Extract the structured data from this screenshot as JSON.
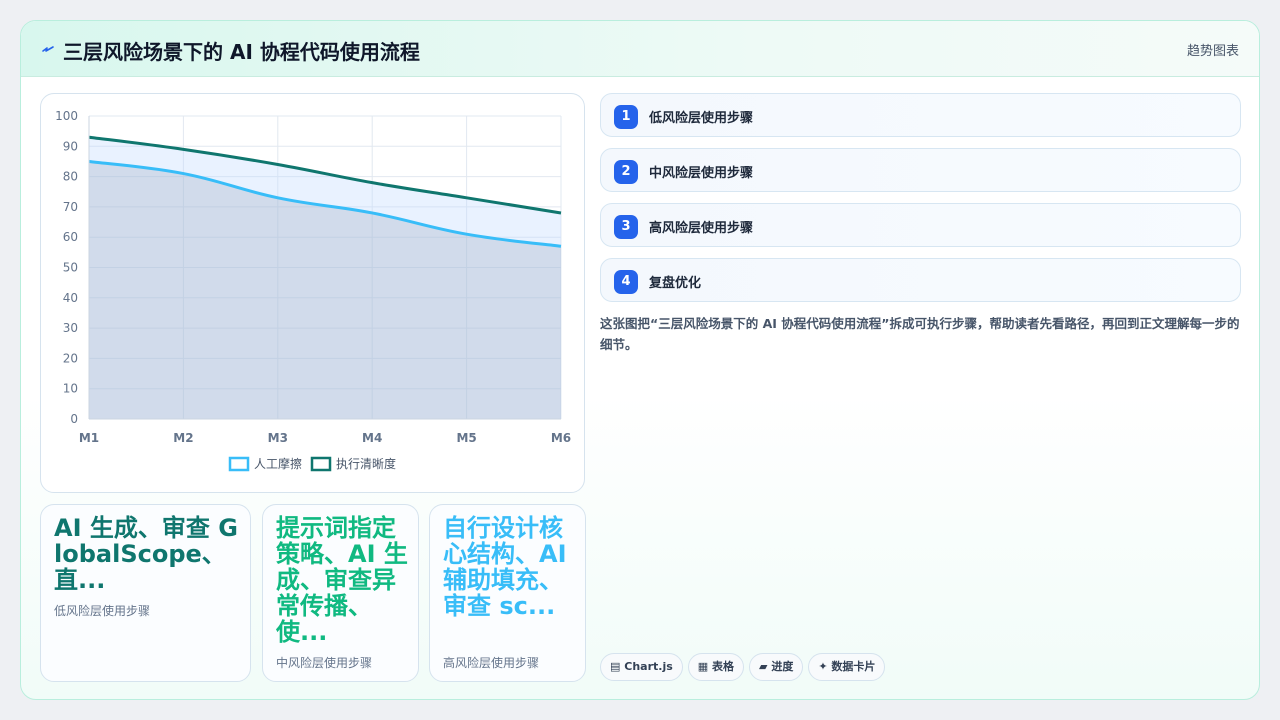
{
  "header": {
    "icon": "lightning-icon",
    "title": "三层风险场景下的 AI 协程代码使用流程",
    "badge": "趋势图表"
  },
  "chart_data": {
    "type": "area",
    "x": [
      "M1",
      "M2",
      "M3",
      "M4",
      "M5",
      "M6"
    ],
    "series": [
      {
        "name": "人工摩擦",
        "values": [
          85,
          81,
          73,
          68,
          61,
          57
        ],
        "color": "#38bdf8"
      },
      {
        "name": "执行清晰度",
        "values": [
          93,
          89,
          84,
          78,
          73,
          68
        ],
        "color": "#0f766e"
      }
    ],
    "ylim": [
      0,
      100
    ],
    "yticks": [
      0,
      10,
      20,
      30,
      40,
      50,
      60,
      70,
      80,
      90,
      100
    ],
    "grid": true,
    "legend": "bottom"
  },
  "metrics": [
    {
      "value": "AI 生成、审查 GlobalScope、直...",
      "label": "低风险层使用步骤",
      "color": "#0f766e"
    },
    {
      "value": "提示词指定策略、AI 生成、审查异常传播、使...",
      "label": "中风险层使用步骤",
      "color": "#10b981"
    },
    {
      "value": "自行设计核心结构、AI 辅助填充、审查 sc...",
      "label": "高风险层使用步骤",
      "color": "#38bdf8"
    }
  ],
  "steps": [
    {
      "num": "1",
      "label": "低风险层使用步骤"
    },
    {
      "num": "2",
      "label": "中风险层使用步骤"
    },
    {
      "num": "3",
      "label": "高风险层使用步骤"
    },
    {
      "num": "4",
      "label": "复盘优化"
    }
  ],
  "description": "这张图把“三层风险场景下的 AI 协程代码使用流程”拆成可执行步骤，帮助读者先看路径，再回到正文理解每一步的细节。",
  "tags": [
    {
      "icon": "chart-icon",
      "glyph": "▤",
      "label": "Chart.js"
    },
    {
      "icon": "table-icon",
      "glyph": "▦",
      "label": "表格"
    },
    {
      "icon": "progress-icon",
      "glyph": "▰",
      "label": "进度"
    },
    {
      "icon": "sparkle-icon",
      "glyph": "✦",
      "label": "数据卡片"
    }
  ]
}
